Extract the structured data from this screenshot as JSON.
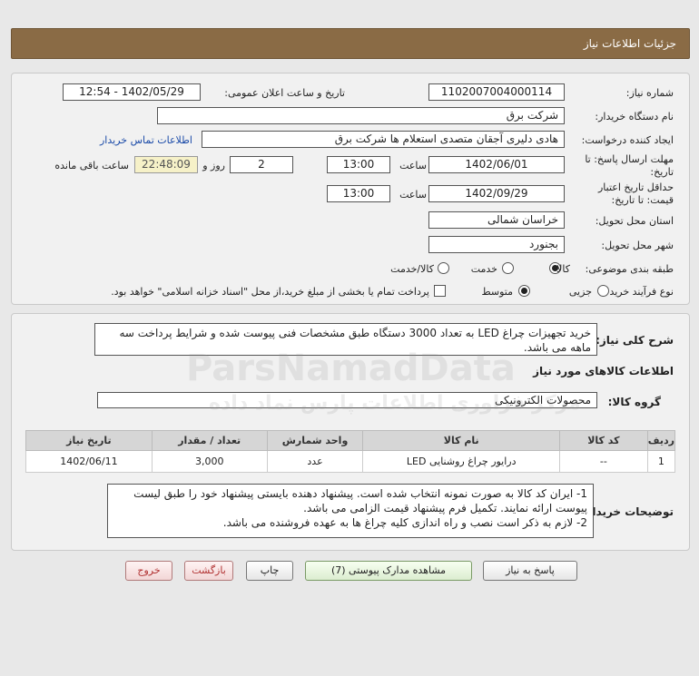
{
  "header": {
    "title": "جزئیات اطلاعات نیاز"
  },
  "form": {
    "need_number_label": "شماره نیاز:",
    "need_number": "1102007004000114",
    "announce_label": "تاریخ و ساعت اعلان عمومی:",
    "announce_value": "1402/05/29 - 12:54",
    "buyer_org_label": "نام دستگاه خریدار:",
    "buyer_org": "شرکت برق",
    "requester_label": "ایجاد کننده درخواست:",
    "requester": "هادی دلیری آجقان متصدی استعلام ها  شرکت برق",
    "contact_link": "اطلاعات تماس خریدار",
    "deadline_label_1": "مهلت ارسال پاسخ: تا",
    "deadline_label_2": "تاریخ:",
    "deadline_date": "1402/06/01",
    "time_label": "ساعت",
    "deadline_time": "13:00",
    "days_value": "2",
    "days_label": "روز و",
    "remaining_time": "22:48:09",
    "remaining_label": "ساعت باقی مانده",
    "validity_label_1": "حداقل تاریخ اعتبار",
    "validity_label_2": "قیمت: تا تاریخ:",
    "validity_date": "1402/09/29",
    "validity_time_label": "ساعت",
    "validity_time": "13:00",
    "province_label": "استان محل تحویل:",
    "province": "خراسان شمالی",
    "city_label": "شهر محل تحویل:",
    "city": "بجنورد",
    "category_label": "طبقه بندی موضوعی:",
    "category_options": [
      "کالا",
      "خدمت",
      "کالا/خدمت"
    ],
    "purchase_type_label": "نوع فرآیند خرید :",
    "purchase_options": [
      "جزیی",
      "متوسط"
    ],
    "payment_note": "پرداخت تمام یا بخشی از مبلغ خرید،از محل \"اسناد خزانه اسلامی\" خواهد بود."
  },
  "details": {
    "summary_label": "شرح کلی نیاز:",
    "summary": "خرید تجهیزات چراغ LED به تعداد 3000 دستگاه طبق مشخصات فنی پیوست شده و شرایط پرداخت سه ماهه می باشد.",
    "goods_info_title": "اطلاعات کالاهای مورد نیاز",
    "goods_group_label": "گروه کالا:",
    "goods_group": "محصولات الکترونیکی",
    "table": {
      "headers": [
        "ردیف",
        "کد کالا",
        "نام کالا",
        "واحد شمارش",
        "تعداد / مقدار",
        "تاریخ نیاز"
      ],
      "rows": [
        [
          "1",
          "--",
          "درایور چراغ روشنایی LED",
          "عدد",
          "3,000",
          "1402/06/11"
        ]
      ]
    },
    "buyer_notes_label": "توضیحات خریدار:",
    "buyer_notes": [
      "1- ایران کد کالا به صورت نمونه انتخاب شده است. پیشنهاد دهنده بایستی پیشنهاد خود را طبق لیست پیوست ارائه نمایند. تکمیل فرم پیشنهاد قیمت الزامی می باشد.",
      "2- لازم به ذکر است نصب و راه اندازی کلیه چراغ ها به عهده فروشنده می باشد."
    ]
  },
  "buttons": {
    "reply": "پاسخ به نیاز",
    "view_docs": "مشاهده مدارک پیوستی (7)",
    "print": "چاپ",
    "back": "بازگشت",
    "exit": "خروج"
  },
  "watermark": {
    "main": "ParsNamadData",
    "sub": "مرکز فراوری اطلاعات پارس نماد داده"
  }
}
